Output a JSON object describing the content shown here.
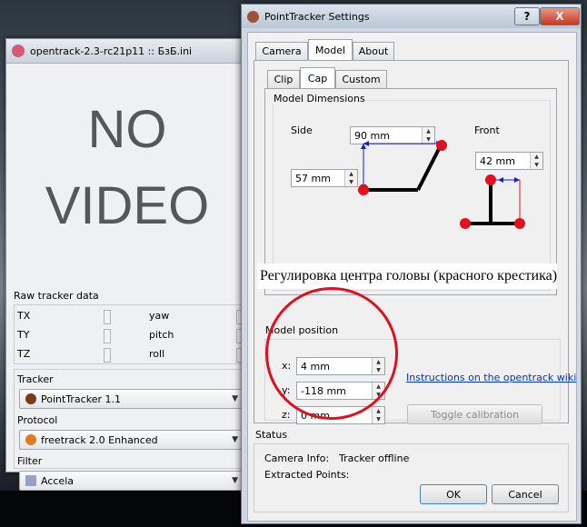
{
  "opentrack": {
    "title": "opentrack-2.3-rc21p11 :: БзБ.ini",
    "no_video": [
      "NO",
      "VIDEO"
    ],
    "raw_label": "Raw tracker data",
    "raw_rows": [
      {
        "left": "TX",
        "right": "yaw"
      },
      {
        "left": "TY",
        "right": "pitch"
      },
      {
        "left": "TZ",
        "right": "roll"
      }
    ],
    "tracker_label": "Tracker",
    "tracker_value": "PointTracker 1.1",
    "protocol_label": "Protocol",
    "protocol_value": "freetrack 2.0 Enhanced",
    "filter_label": "Filter",
    "filter_value": "Accela"
  },
  "settings": {
    "title": "PointTracker Settings",
    "help_btn": "?",
    "close_btn": "X",
    "tabs": [
      "Camera",
      "Model",
      "About"
    ],
    "subtabs": [
      "Clip",
      "Cap",
      "Custom"
    ],
    "dims_title": "Model Dimensions",
    "side_label": "Side",
    "front_label": "Front",
    "side_width": "90 mm",
    "side_height": "57 mm",
    "front_width": "42 mm",
    "annotation": "Регулировка центра головы (красного крестика)",
    "position_title": "Model position",
    "x_label": "x:",
    "x_value": "4 mm",
    "y_label": "y:",
    "y_value": "-118 mm",
    "z_label": "z:",
    "z_value": "0 mm",
    "wiki_link": "Instructions on the opentrack wiki",
    "toggle_btn": "Toggle calibration",
    "status_title": "Status",
    "camera_info_label": "Camera Info:",
    "camera_info_value": "Tracker offline",
    "extracted_label": "Extracted Points:",
    "ok": "OK",
    "cancel": "Cancel"
  },
  "colors": {
    "red": "#e0101e",
    "blue": "#1a1adc",
    "link": "#0033cc"
  }
}
